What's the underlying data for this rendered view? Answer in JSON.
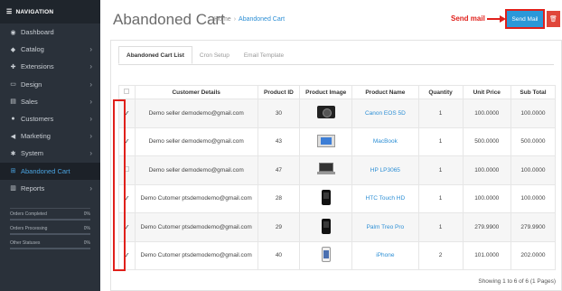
{
  "sidebar": {
    "header": "NAVIGATION",
    "items": [
      {
        "label": "Dashboard",
        "icon": "dashboard-icon",
        "glyph": "◉",
        "chevron": false,
        "active": false
      },
      {
        "label": "Catalog",
        "icon": "tag-icon",
        "glyph": "◆",
        "chevron": true,
        "active": false
      },
      {
        "label": "Extensions",
        "icon": "puzzle-icon",
        "glyph": "✚",
        "chevron": true,
        "active": false
      },
      {
        "label": "Design",
        "icon": "monitor-icon",
        "glyph": "▭",
        "chevron": true,
        "active": false
      },
      {
        "label": "Sales",
        "icon": "cart-icon",
        "glyph": "▤",
        "chevron": true,
        "active": false
      },
      {
        "label": "Customers",
        "icon": "user-icon",
        "glyph": "●",
        "chevron": true,
        "active": false
      },
      {
        "label": "Marketing",
        "icon": "share-icon",
        "glyph": "◀",
        "chevron": true,
        "active": false
      },
      {
        "label": "System",
        "icon": "gear-icon",
        "glyph": "✱",
        "chevron": true,
        "active": false
      },
      {
        "label": "Abandoned Cart",
        "icon": "cart-icon",
        "glyph": "⊞",
        "chevron": false,
        "active": true
      },
      {
        "label": "Reports",
        "icon": "bar-chart-icon",
        "glyph": "▥",
        "chevron": true,
        "active": false
      }
    ],
    "stats": [
      {
        "label": "Orders Completed",
        "value": "0%"
      },
      {
        "label": "Orders Processing",
        "value": "0%"
      },
      {
        "label": "Other Statuses",
        "value": "0%"
      }
    ]
  },
  "header": {
    "title": "Abandoned Cart",
    "breadcrumb_home": "Home",
    "breadcrumb_sep": "›",
    "breadcrumb_current": "Abandoned Cart",
    "annotation": "Send mail",
    "send_button": "Send Mail",
    "delete_icon": "trash-icon"
  },
  "tabs": [
    {
      "label": "Abandoned Cart List",
      "active": true
    },
    {
      "label": "Cron Setup",
      "active": false
    },
    {
      "label": "Email Template",
      "active": false
    }
  ],
  "table": {
    "headers": [
      "",
      "Customer Details",
      "Product ID",
      "Product Image",
      "Product Name",
      "Quantity",
      "Unit Price",
      "Sub Total"
    ],
    "rows": [
      {
        "checked": true,
        "customer": "Demo seller demodemo@gmail.com",
        "product_id": "30",
        "image": "camera",
        "product_name": "Canon EOS 5D",
        "quantity": "1",
        "unit_price": "100.0000",
        "sub_total": "100.0000"
      },
      {
        "checked": true,
        "customer": "Demo seller demodemo@gmail.com",
        "product_id": "43",
        "image": "tablet",
        "product_name": "MacBook",
        "quantity": "1",
        "unit_price": "500.0000",
        "sub_total": "500.0000"
      },
      {
        "checked": false,
        "customer": "Demo seller demodemo@gmail.com",
        "product_id": "47",
        "image": "laptop",
        "product_name": "HP LP3065",
        "quantity": "1",
        "unit_price": "100.0000",
        "sub_total": "100.0000"
      },
      {
        "checked": true,
        "customer": "Demo Cutomer ptsdemodemo@gmail.com",
        "product_id": "28",
        "image": "phone",
        "product_name": "HTC Touch HD",
        "quantity": "1",
        "unit_price": "100.0000",
        "sub_total": "100.0000"
      },
      {
        "checked": true,
        "customer": "Demo Cutomer ptsdemodemo@gmail.com",
        "product_id": "29",
        "image": "phone",
        "product_name": "Palm Treo Pro",
        "quantity": "1",
        "unit_price": "279.9900",
        "sub_total": "279.9900"
      },
      {
        "checked": true,
        "customer": "Demo Cutomer ptsdemodemo@gmail.com",
        "product_id": "40",
        "image": "iphone",
        "product_name": "iPhone",
        "quantity": "2",
        "unit_price": "101.0000",
        "sub_total": "202.0000"
      }
    ]
  },
  "footer": "Showing 1 to 6 of 6 (1 Pages)",
  "colors": {
    "accent": "#2b98d9",
    "danger": "#e0463a",
    "annotation": "#e0201b",
    "sidebar": "#2a313a"
  }
}
